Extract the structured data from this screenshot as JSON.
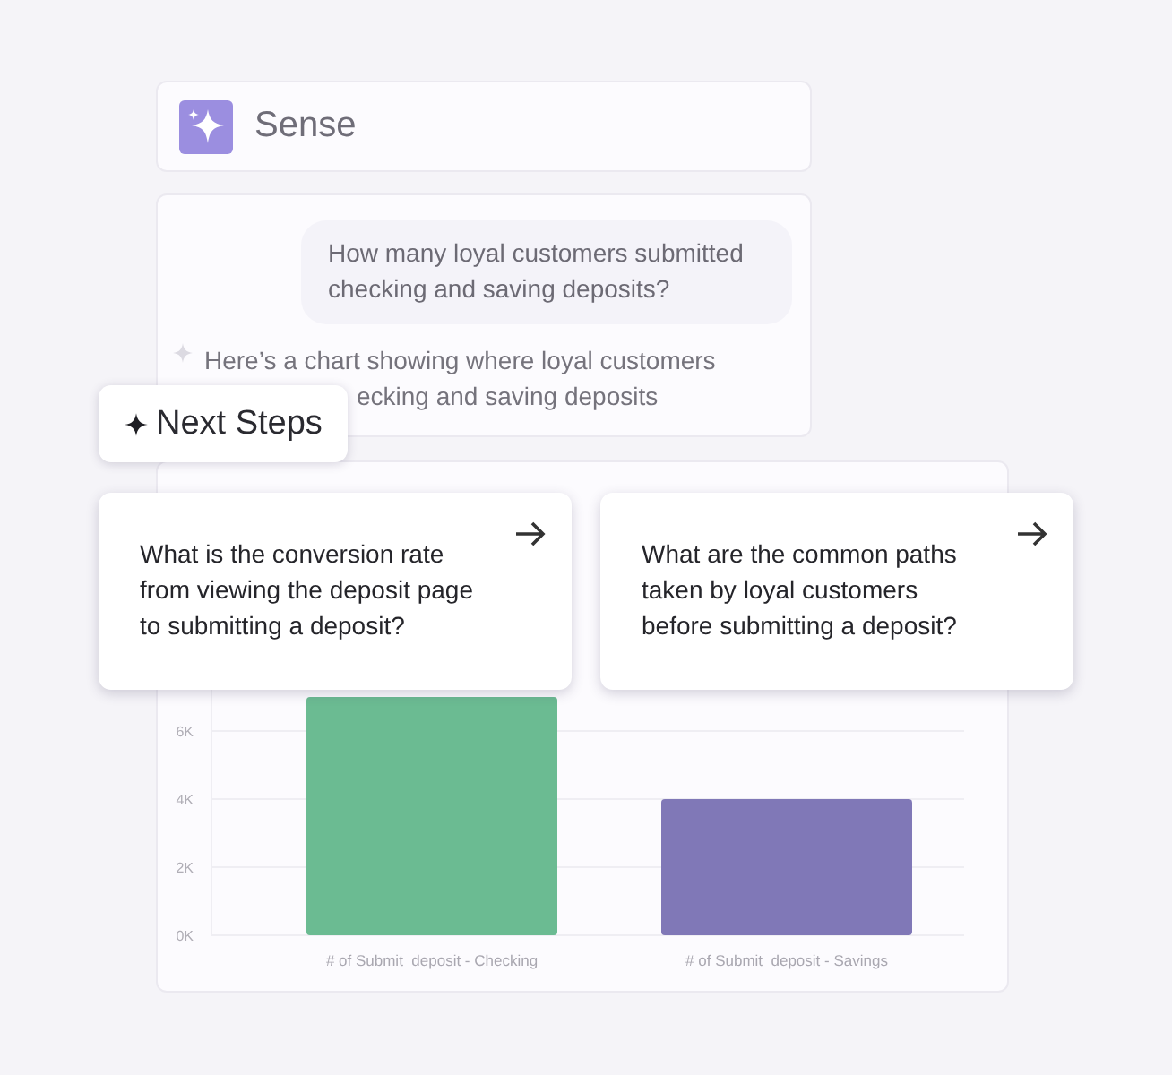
{
  "header": {
    "title": "Sense"
  },
  "chat": {
    "question": "How many loyal customers submitted checking and saving deposits?",
    "answer_lines": [
      "Here’s a chart showing where loyal customers",
      "ecking and saving deposits"
    ]
  },
  "chart": {
    "chart_data": {
      "type": "bar",
      "categories": [
        "# of Submit  deposit - Checking",
        "# of Submit  deposit - Savings"
      ],
      "series": [
        {
          "color": "#6bbb92",
          "values": [
            7000,
            null
          ]
        },
        {
          "color": "#8078b7",
          "values": [
            null,
            4000
          ]
        }
      ],
      "ylim": [
        0,
        8000
      ],
      "grid": true,
      "yticks": [
        {
          "value": 0,
          "label": "0K"
        },
        {
          "value": 2000,
          "label": "2K"
        },
        {
          "value": 4000,
          "label": "4K"
        },
        {
          "value": 6000,
          "label": "6K"
        }
      ]
    }
  },
  "next_steps": {
    "title": "Next Steps"
  },
  "suggestions": [
    {
      "text": "What is the conversion rate from viewing the deposit page to submitting a deposit?"
    },
    {
      "text": "What are the common paths taken by loyal customers before submitting a deposit?"
    }
  ]
}
